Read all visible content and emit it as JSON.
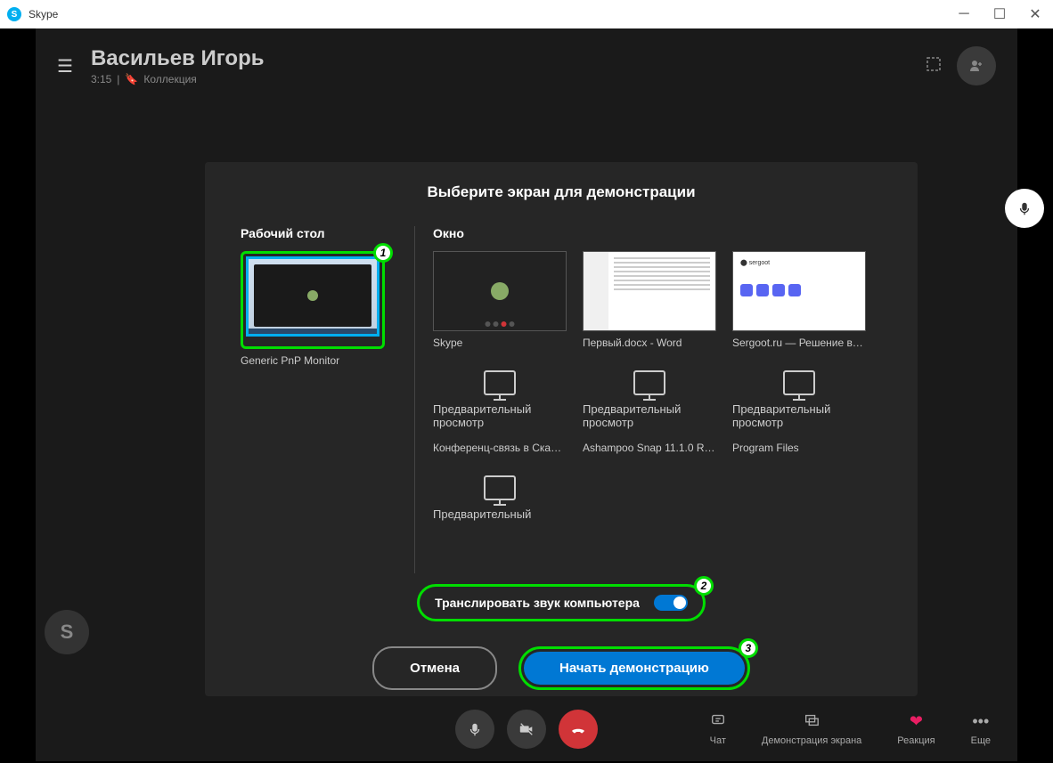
{
  "titlebar": {
    "app_name": "Skype"
  },
  "header": {
    "contact_name": "Васильев Игорь",
    "time": "3:15",
    "collection_label": "Коллекция"
  },
  "modal": {
    "title": "Выберите экран для демонстрации",
    "desktop_label": "Рабочий стол",
    "window_label": "Окно",
    "desktop_item": "Generic PnP Monitor",
    "windows_row1": [
      {
        "label": "Skype"
      },
      {
        "label": "Первый.docx - Word"
      },
      {
        "label": "Sergoot.ru — Решение ва..."
      }
    ],
    "windows_row2": [
      {
        "label": "Конференц-связь в Скайпе"
      },
      {
        "label": "Ashampoo Snap 11.1.0 Re..."
      },
      {
        "label": "Program Files"
      }
    ],
    "preview_label": "Предварительный просмотр",
    "preview_label_short": "Предварительный",
    "audio_label": "Транслировать звук компьютера",
    "cancel_button": "Отмена",
    "start_button": "Начать демонстрацию"
  },
  "bottom": {
    "chat": "Чат",
    "share": "Демонстрация экрана",
    "reaction": "Реакция",
    "more": "Еще"
  },
  "annotations": {
    "a1": "1",
    "a2": "2",
    "a3": "3"
  }
}
